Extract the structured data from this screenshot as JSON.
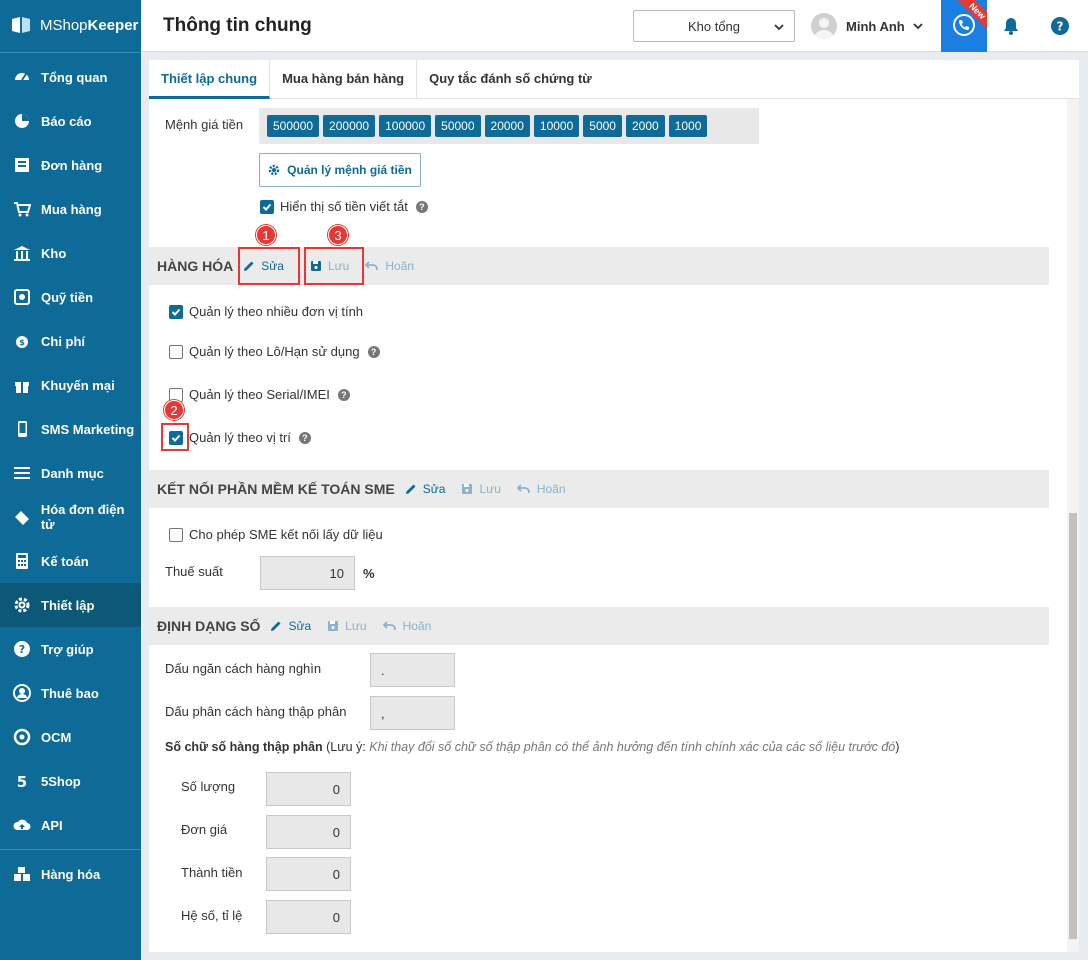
{
  "app": {
    "brand_light": "MShop",
    "brand_bold": "Keeper"
  },
  "sidebar": {
    "items": [
      {
        "label": "Tổng quan",
        "icon": "dashboard-icon"
      },
      {
        "label": "Báo cáo",
        "icon": "pie-chart-icon"
      },
      {
        "label": "Đơn hàng",
        "icon": "order-icon"
      },
      {
        "label": "Mua hàng",
        "icon": "cart-icon"
      },
      {
        "label": "Kho",
        "icon": "warehouse-icon"
      },
      {
        "label": "Quỹ tiền",
        "icon": "safe-icon"
      },
      {
        "label": "Chi phí",
        "icon": "expense-icon"
      },
      {
        "label": "Khuyến mại",
        "icon": "gift-icon"
      },
      {
        "label": "SMS Marketing",
        "icon": "phone-icon"
      },
      {
        "label": "Danh mục",
        "icon": "list-icon"
      },
      {
        "label": "Hóa đơn điện tử",
        "icon": "einvoice-icon"
      },
      {
        "label": "Kế toán",
        "icon": "calculator-icon"
      },
      {
        "label": "Thiết lập",
        "icon": "gear-icon"
      },
      {
        "label": "Trợ giúp",
        "icon": "help-icon"
      },
      {
        "label": "Thuê bao",
        "icon": "user-icon"
      },
      {
        "label": "OCM",
        "icon": "ocm-icon"
      },
      {
        "label": "5Shop",
        "icon": "5shop-icon"
      },
      {
        "label": "API",
        "icon": "cloud-upload-icon"
      },
      {
        "label": "Hàng hóa",
        "icon": "goods-icon"
      }
    ],
    "active": "Thiết lập"
  },
  "header": {
    "title": "Thông tin chung",
    "store": "Kho tổng",
    "user": "Minh Anh",
    "new_badge": "New"
  },
  "tabs": [
    {
      "label": "Thiết lập chung",
      "active": true
    },
    {
      "label": "Mua hàng bán hàng",
      "active": false
    },
    {
      "label": "Quy tắc đánh số chứng từ",
      "active": false
    }
  ],
  "money": {
    "label": "Mệnh giá tiền",
    "denominations": [
      "500000",
      "200000",
      "100000",
      "50000",
      "20000",
      "10000",
      "5000",
      "2000",
      "1000"
    ],
    "manage_button": "Quản lý mệnh giá tiền",
    "abbrev_label": "Hiển thị số tiền viết tắt",
    "abbrev_checked": true
  },
  "actions": {
    "edit": "Sửa",
    "save": "Lưu",
    "cancel": "Hoãn"
  },
  "goods": {
    "title": "HÀNG HÓA",
    "options": [
      {
        "label": "Quản lý theo nhiều đơn vị tính",
        "checked": true
      },
      {
        "label": "Quản lý theo Lô/Hạn sử dụng",
        "checked": false
      },
      {
        "label": "Quản lý theo Serial/IMEI",
        "checked": false
      },
      {
        "label": "Quản lý theo vị trí",
        "checked": true
      }
    ]
  },
  "sme": {
    "title": "KẾT NỐI PHẦN MỀM KẾ TOÁN SME",
    "allow_label": "Cho phép SME kết nối lấy dữ liệu",
    "allow_checked": false,
    "tax_label": "Thuế suất",
    "tax_value": "10",
    "tax_unit": "%"
  },
  "number_format": {
    "title": "ĐỊNH DẠNG SỐ",
    "thousand_label": "Dấu ngăn cách hàng nghìn",
    "thousand_value": ".",
    "decimal_label": "Dấu phân cách hàng thập phân",
    "decimal_value": ",",
    "decimals_heading": "Số chữ số hàng thập phân",
    "note_open": " (Lưu ý: ",
    "note_text": "Khi thay đổi số chữ số thập phân có thể ảnh hưởng đến tính chính xác của các số liệu trước đó",
    "note_close": ")",
    "fields": [
      {
        "label": "Số lượng",
        "value": "0"
      },
      {
        "label": "Đơn giá",
        "value": "0"
      },
      {
        "label": "Thành tiền",
        "value": "0"
      },
      {
        "label": "Hệ số, tỉ lệ",
        "value": "0"
      }
    ]
  },
  "markers": [
    "1",
    "2",
    "3"
  ],
  "colors": {
    "sidebar": "#0e6a96",
    "accent": "#1a7fe0",
    "highlight": "#e53935"
  }
}
